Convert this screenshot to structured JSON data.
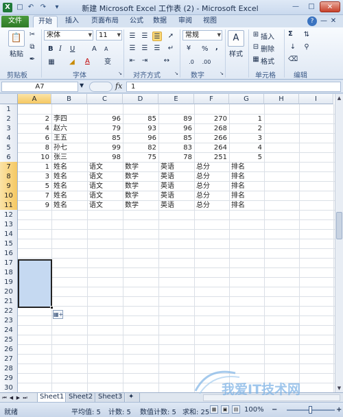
{
  "window": {
    "title": "新建 Microsoft Excel 工作表 (2) - Microsoft Excel",
    "app_icon": "excel-icon",
    "quick_access": [
      "save-icon",
      "undo-icon",
      "redo-icon",
      "customize-icon"
    ],
    "controls": [
      "minimize-icon",
      "maximize-icon",
      "close-icon"
    ]
  },
  "ribbon_tabs": [
    "文件",
    "开始",
    "插入",
    "页面布局",
    "公式",
    "数据",
    "审阅",
    "视图"
  ],
  "ribbon_tabs_active": "开始",
  "ribbon": {
    "clipboard": {
      "paste_label": "粘贴",
      "group_label": "剪贴板"
    },
    "font": {
      "font_name": "宋体",
      "font_size": "11",
      "bold": "B",
      "italic": "I",
      "underline": "U",
      "grow": "A",
      "shrink": "A",
      "font_color_glyph": "A",
      "group_label": "字体"
    },
    "alignment": {
      "group_label": "对齐方式"
    },
    "number": {
      "format": "常规",
      "percent": "%",
      "comma": ",",
      "group_label": "数字"
    },
    "styles": {
      "label": "样式"
    },
    "cells": {
      "insert": "插入",
      "delete": "删除",
      "format": "格式",
      "group_label": "单元格"
    },
    "editing": {
      "sum": "Σ",
      "group_label": "编辑"
    },
    "accent": "#2f7a26"
  },
  "formula_bar": {
    "name_box": "A7",
    "fx": "fx",
    "formula": "1"
  },
  "sheet": {
    "columns": [
      "A",
      "B",
      "C",
      "D",
      "E",
      "F",
      "G",
      "H",
      "I"
    ],
    "selected_column": "A",
    "rows": [
      "1",
      "2",
      "3",
      "4",
      "5",
      "6",
      "7",
      "8",
      "9",
      "10",
      "11",
      "12",
      "13",
      "14",
      "15",
      "16",
      "17",
      "18",
      "19",
      "20",
      "21",
      "22",
      "23",
      "24",
      "25",
      "26",
      "27",
      "28",
      "29",
      "30"
    ],
    "data": [
      {
        "A": "2",
        "B": "李四",
        "C": "96",
        "D": "85",
        "E": "89",
        "F": "270",
        "G": "1"
      },
      {
        "A": "4",
        "B": "赵六",
        "C": "79",
        "D": "93",
        "E": "96",
        "F": "268",
        "G": "2"
      },
      {
        "A": "6",
        "B": "王五",
        "C": "85",
        "D": "96",
        "E": "85",
        "F": "266",
        "G": "3"
      },
      {
        "A": "8",
        "B": "孙七",
        "C": "99",
        "D": "82",
        "E": "83",
        "F": "264",
        "G": "4"
      },
      {
        "A": "10",
        "B": "张三",
        "C": "98",
        "D": "75",
        "E": "78",
        "F": "251",
        "G": "5"
      },
      {
        "A": "1",
        "B": "姓名",
        "C": "语文",
        "D": "数学",
        "E": "英语",
        "F": "总分",
        "G": "排名"
      },
      {
        "A": "3",
        "B": "姓名",
        "C": "语文",
        "D": "数学",
        "E": "英语",
        "F": "总分",
        "G": "排名"
      },
      {
        "A": "5",
        "B": "姓名",
        "C": "语文",
        "D": "数学",
        "E": "英语",
        "F": "总分",
        "G": "排名"
      },
      {
        "A": "7",
        "B": "姓名",
        "C": "语文",
        "D": "数学",
        "E": "英语",
        "F": "总分",
        "G": "排名"
      },
      {
        "A": "9",
        "B": "姓名",
        "C": "语文",
        "D": "数学",
        "E": "英语",
        "F": "总分",
        "G": "排名"
      }
    ],
    "selection_range": "A7:A11",
    "selection_color": "#c5d9f1"
  },
  "sheet_tabs": [
    "Sheet1",
    "Sheet2",
    "Sheet3"
  ],
  "active_sheet": "Sheet1",
  "status": {
    "ready": "就绪",
    "average": "平均值: 5",
    "count": "计数: 5",
    "numeric_count": "数值计数: 5",
    "sum": "求和: 25",
    "zoom": "100%"
  },
  "watermark": {
    "text": "我爱IT技术网"
  }
}
